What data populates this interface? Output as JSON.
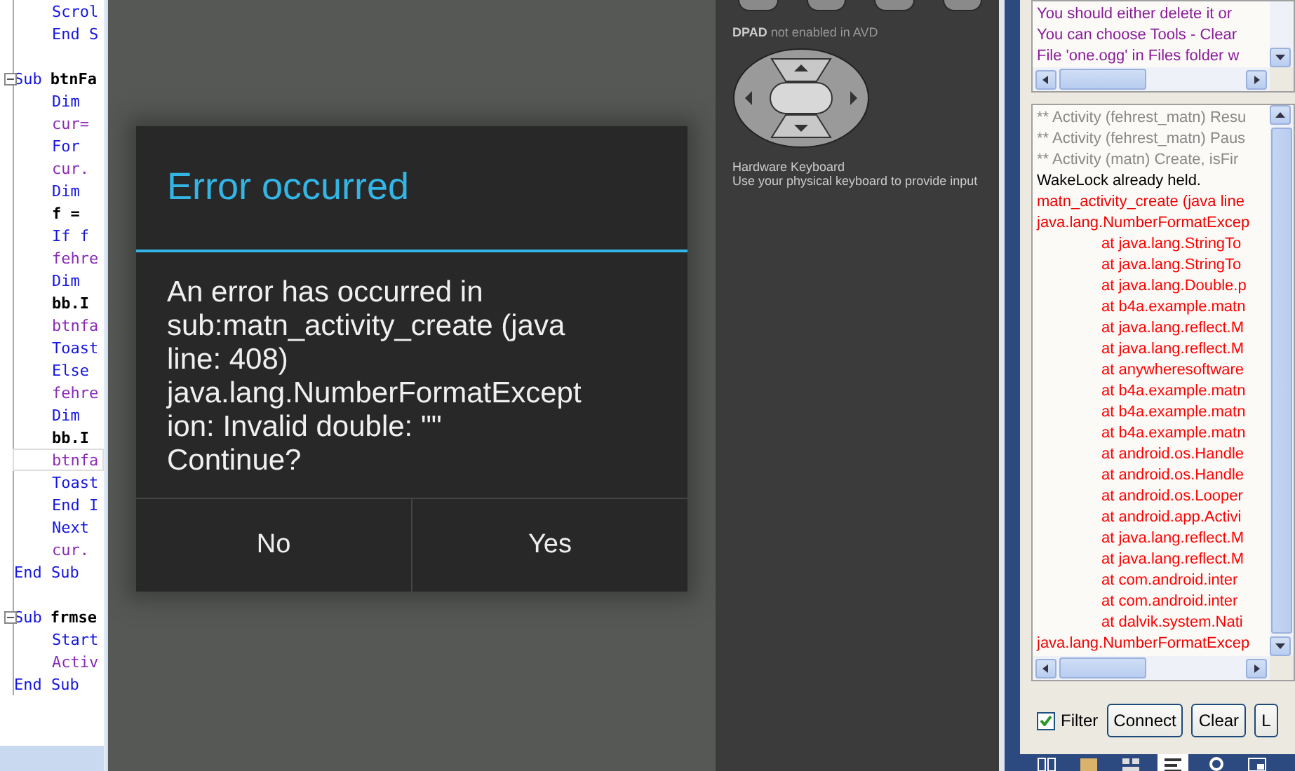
{
  "code_editor": {
    "lines": [
      {
        "indent": true,
        "fold": false,
        "current": false,
        "tokens": [
          {
            "text": "Scrol",
            "kind": "keyword"
          }
        ]
      },
      {
        "indent": true,
        "fold": false,
        "current": false,
        "tokens": [
          {
            "text": "End S",
            "kind": "keyword"
          }
        ]
      },
      {
        "fold": false,
        "current": false
      },
      {
        "indent": false,
        "fold": true,
        "current": false,
        "tokens": [
          {
            "text": "Sub",
            "kind": "keyword"
          },
          {
            "text": "btnFa",
            "kind": "name"
          }
        ]
      },
      {
        "indent": true,
        "fold": false,
        "current": false,
        "tokens": [
          {
            "text": "Dim",
            "kind": "keyword"
          }
        ]
      },
      {
        "indent": true,
        "fold": false,
        "current": false,
        "tokens": [
          {
            "text": "cur=",
            "kind": "variable"
          }
        ]
      },
      {
        "indent": true,
        "fold": false,
        "current": false,
        "tokens": [
          {
            "text": "For",
            "kind": "keyword"
          }
        ]
      },
      {
        "indent": true,
        "fold": false,
        "current": false,
        "tokens": [
          {
            "text": "cur.",
            "kind": "variable"
          }
        ]
      },
      {
        "indent": true,
        "fold": false,
        "current": false,
        "tokens": [
          {
            "text": "Dim",
            "kind": "keyword"
          }
        ]
      },
      {
        "indent": true,
        "fold": false,
        "current": false,
        "tokens": [
          {
            "text": "f =",
            "kind": "plain"
          }
        ]
      },
      {
        "indent": true,
        "fold": false,
        "current": false,
        "tokens": [
          {
            "text": "If f",
            "kind": "keyword"
          }
        ]
      },
      {
        "indent": true,
        "fold": false,
        "current": false,
        "tokens": [
          {
            "text": "fehre",
            "kind": "variable"
          }
        ]
      },
      {
        "indent": true,
        "fold": false,
        "current": false,
        "tokens": [
          {
            "text": "Dim",
            "kind": "keyword"
          }
        ]
      },
      {
        "indent": true,
        "fold": false,
        "current": false,
        "tokens": [
          {
            "text": "bb.I",
            "kind": "plain"
          }
        ]
      },
      {
        "indent": true,
        "fold": false,
        "current": false,
        "tokens": [
          {
            "text": "btnfa",
            "kind": "variable"
          }
        ]
      },
      {
        "indent": true,
        "fold": false,
        "current": false,
        "tokens": [
          {
            "text": "Toast",
            "kind": "keyword"
          }
        ]
      },
      {
        "indent": true,
        "fold": false,
        "current": false,
        "tokens": [
          {
            "text": "Else",
            "kind": "keyword"
          }
        ]
      },
      {
        "indent": true,
        "fold": false,
        "current": false,
        "tokens": [
          {
            "text": "fehre",
            "kind": "variable"
          }
        ]
      },
      {
        "indent": true,
        "fold": false,
        "current": false,
        "tokens": [
          {
            "text": "Dim",
            "kind": "keyword"
          }
        ]
      },
      {
        "indent": true,
        "fold": false,
        "current": false,
        "tokens": [
          {
            "text": "bb.I",
            "kind": "plain"
          }
        ]
      },
      {
        "indent": true,
        "fold": false,
        "current": true,
        "tokens": [
          {
            "text": "btnfa",
            "kind": "variable"
          }
        ]
      },
      {
        "indent": true,
        "fold": false,
        "current": false,
        "tokens": [
          {
            "text": "Toast",
            "kind": "keyword"
          }
        ]
      },
      {
        "indent": true,
        "fold": false,
        "current": false,
        "tokens": [
          {
            "text": "End I",
            "kind": "keyword"
          }
        ]
      },
      {
        "indent": true,
        "fold": false,
        "current": false,
        "tokens": [
          {
            "text": "Next",
            "kind": "keyword"
          }
        ]
      },
      {
        "indent": true,
        "fold": false,
        "current": false,
        "tokens": [
          {
            "text": "cur.",
            "kind": "variable"
          }
        ]
      },
      {
        "indent": false,
        "fold": false,
        "current": false,
        "tokens": [
          {
            "text": "End Sub",
            "kind": "keyword"
          }
        ]
      },
      {
        "fold": false,
        "current": false
      },
      {
        "indent": false,
        "fold": true,
        "current": false,
        "tokens": [
          {
            "text": "Sub",
            "kind": "keyword"
          },
          {
            "text": "frmse",
            "kind": "name"
          }
        ]
      },
      {
        "indent": true,
        "fold": false,
        "current": false,
        "tokens": [
          {
            "text": "Start",
            "kind": "keyword"
          }
        ]
      },
      {
        "indent": true,
        "fold": false,
        "current": false,
        "tokens": [
          {
            "text": "Activ",
            "kind": "variable"
          }
        ]
      },
      {
        "indent": false,
        "fold": false,
        "current": false,
        "tokens": [
          {
            "text": "End Sub",
            "kind": "keyword"
          }
        ]
      }
    ]
  },
  "dialog": {
    "title": "Error occurred",
    "message": "An error has occurred in\nsub:matn_activity_create (java\nline: 408)\njava.lang.NumberFormatExcept\nion: Invalid double: \"\"\nContinue?",
    "buttons": [
      "No",
      "Yes"
    ]
  },
  "emulator_controls": {
    "dpad_note": "**DPAD** not enabled in AVD",
    "keyboard_title": "Hardware Keyboard",
    "keyboard_note": "Use your physical keyboard to provide input"
  },
  "top_log": {
    "lines": [
      {
        "text": "You should either delete it or",
        "kind": "warning"
      },
      {
        "text": "You can choose Tools - Clear",
        "kind": "warning"
      },
      {
        "text": "File 'one.ogg' in Files folder w",
        "kind": "warning"
      }
    ]
  },
  "main_log": {
    "lines": [
      {
        "text": "** Activity (fehrest_matn) Resu",
        "kind": "info"
      },
      {
        "text": "** Activity (fehrest_matn) Paus",
        "kind": "info"
      },
      {
        "text": "** Activity (matn) Create, isFir",
        "kind": "info"
      },
      {
        "text": "WakeLock already held.",
        "kind": "plain"
      },
      {
        "text": "matn_activity_create (java line",
        "kind": "error"
      },
      {
        "text": "java.lang.NumberFormatExcep",
        "kind": "error"
      },
      {
        "text": "at java.lang.StringTo",
        "kind": "trace"
      },
      {
        "text": "at java.lang.StringTo",
        "kind": "trace"
      },
      {
        "text": "at java.lang.Double.p",
        "kind": "trace"
      },
      {
        "text": "at b4a.example.matn",
        "kind": "trace"
      },
      {
        "text": "at java.lang.reflect.M",
        "kind": "trace"
      },
      {
        "text": "at java.lang.reflect.M",
        "kind": "trace"
      },
      {
        "text": "at anywheresoftware",
        "kind": "trace"
      },
      {
        "text": "at b4a.example.matn",
        "kind": "trace"
      },
      {
        "text": "at b4a.example.matn",
        "kind": "trace"
      },
      {
        "text": "at b4a.example.matn",
        "kind": "trace"
      },
      {
        "text": "at android.os.Handle",
        "kind": "trace"
      },
      {
        "text": "at android.os.Handle",
        "kind": "trace"
      },
      {
        "text": "at android.os.Looper",
        "kind": "trace"
      },
      {
        "text": "at android.app.Activi",
        "kind": "trace"
      },
      {
        "text": "at java.lang.reflect.M",
        "kind": "trace"
      },
      {
        "text": "at java.lang.reflect.M",
        "kind": "trace"
      },
      {
        "text": "at com.android.inter",
        "kind": "trace"
      },
      {
        "text": "at com.android.inter",
        "kind": "trace"
      },
      {
        "text": "at dalvik.system.Nati",
        "kind": "trace"
      },
      {
        "text": "java.lang.NumberFormatExcep",
        "kind": "error"
      }
    ]
  },
  "filter": {
    "label": "Filter",
    "checked": true
  },
  "log_buttons": [
    "Connect",
    "Clear",
    "L"
  ],
  "taskbar": {
    "items": [
      {
        "kind": "book",
        "selected": false
      },
      {
        "kind": "folder",
        "selected": false
      },
      {
        "kind": "grid",
        "selected": false
      },
      {
        "kind": "list",
        "selected": true
      },
      {
        "kind": "search",
        "selected": false
      },
      {
        "kind": "window",
        "selected": false
      }
    ]
  }
}
